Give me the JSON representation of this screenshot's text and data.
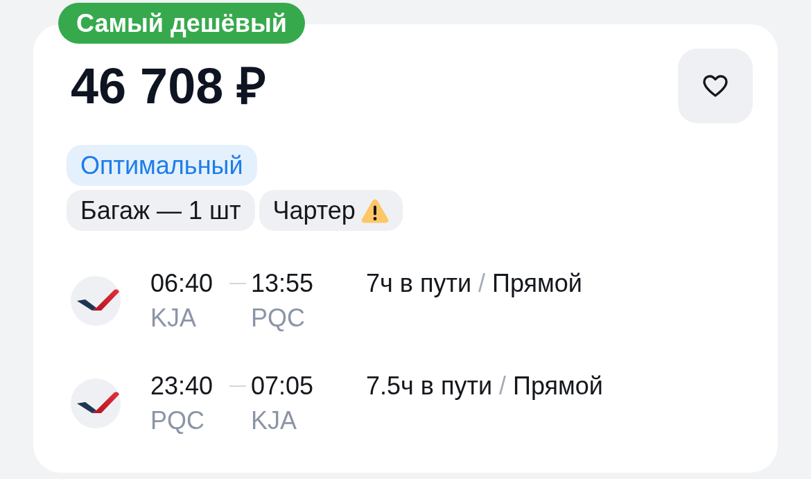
{
  "badge": {
    "label": "Самый дешёвый"
  },
  "price": "46 708 ₽",
  "favorite_button": {
    "on": false
  },
  "tag_rows": [
    [
      {
        "label": "Оптимальный",
        "kind": "fare"
      }
    ],
    [
      {
        "label": "Багаж — 1 шт",
        "kind": "plain"
      },
      {
        "label": "Чартер",
        "kind": "warning"
      }
    ]
  ],
  "flights": [
    {
      "departure_time": "06:40",
      "arrival_time": "13:55",
      "origin": "KJA",
      "destination": "PQC",
      "duration": "7ч в пути",
      "separator": "/",
      "stops": "Прямой"
    },
    {
      "departure_time": "23:40",
      "arrival_time": "07:05",
      "origin": "PQC",
      "destination": "KJA",
      "duration": "7.5ч в пути",
      "separator": "/",
      "stops": "Прямой"
    }
  ]
}
